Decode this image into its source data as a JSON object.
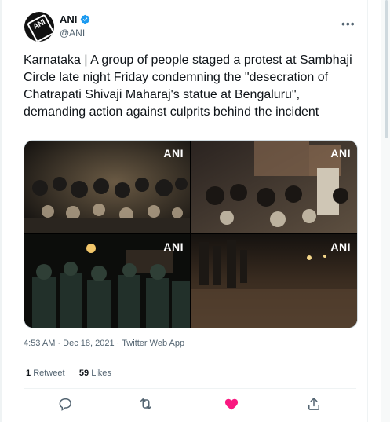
{
  "author": {
    "name": "ANI",
    "handle": "@ANI",
    "avatar_text": "ANI",
    "verified": true
  },
  "tweet": {
    "text": "Karnataka | A group of people staged a protest at Sambhaji Circle late night Friday condemning the \"desecration of Chatrapati Shivaji Maharaj's statue at Bengaluru\", demanding action against culprits behind the incident",
    "watermarks": [
      "ANI",
      "ANI",
      "ANI",
      "ANI"
    ]
  },
  "meta": {
    "time": "4:53 AM",
    "date": "Dec 18, 2021",
    "separator": "·",
    "source": "Twitter Web App"
  },
  "stats": {
    "retweets_count": "1",
    "retweets_label": "Retweet",
    "likes_count": "59",
    "likes_label": "Likes"
  },
  "actions": [
    {
      "icon": "reply-icon"
    },
    {
      "icon": "retweet-icon"
    },
    {
      "icon": "like-icon",
      "active": true,
      "color": "#f91880"
    },
    {
      "icon": "share-icon"
    }
  ],
  "colors": {
    "verified": "#1d9bf0",
    "secondary_text": "#536471",
    "like_active": "#f91880"
  }
}
